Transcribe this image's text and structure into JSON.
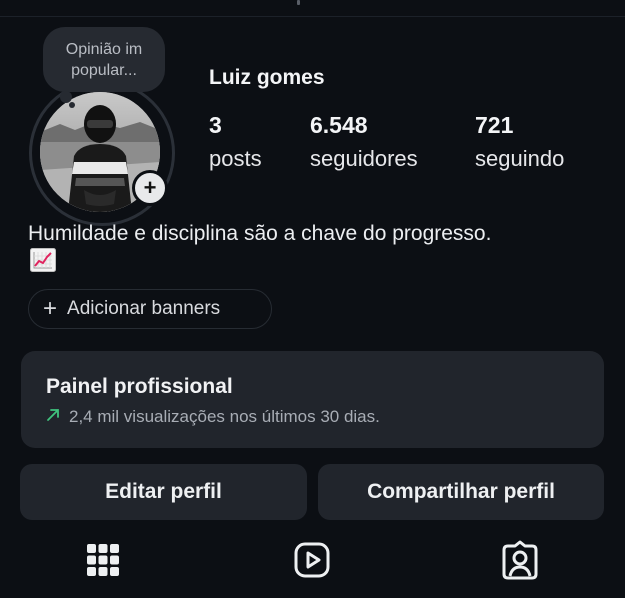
{
  "note": {
    "text": "Opinião im popular..."
  },
  "profile": {
    "name": "Luiz gomes",
    "avatar": "profile-photo-person-in-helmet",
    "add_story_icon": "plus-icon"
  },
  "stats": [
    {
      "value": "3",
      "label": "posts"
    },
    {
      "value": "6.548",
      "label": "seguidores"
    },
    {
      "value": "721",
      "label": "seguindo"
    }
  ],
  "bio": {
    "text": "Humildade e disciplina são a chave do progresso.",
    "emoji_icon": "chart-increasing-icon"
  },
  "banners": {
    "icon": "plus-icon",
    "label": "Adicionar banners"
  },
  "professional_dashboard": {
    "title": "Painel profissional",
    "trend_icon": "arrow-up-right-icon",
    "trend_color": "#3fc37e",
    "subtitle": "2,4 mil visualizações nos últimos 30 dias."
  },
  "actions": {
    "edit_label": "Editar perfil",
    "share_label": "Compartilhar perfil"
  },
  "tabs": [
    {
      "icon": "grid-icon"
    },
    {
      "icon": "reels-icon"
    },
    {
      "icon": "tagged-person-icon"
    }
  ],
  "colors": {
    "background": "#0c0f14",
    "card": "#21252c",
    "note_bubble": "#262a31"
  }
}
